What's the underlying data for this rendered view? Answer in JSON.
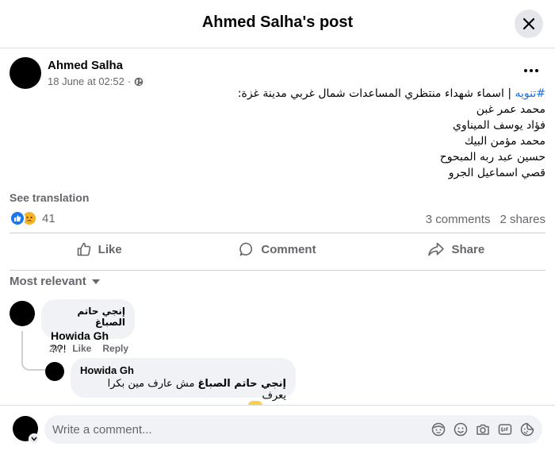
{
  "header": {
    "title": "Ahmed Salha's post",
    "close_icon": "close-icon"
  },
  "post": {
    "author": "Ahmed Salha",
    "timestamp": "18 June at 02:52",
    "audience_icon": "globe-icon",
    "hashtag": "#تنويه",
    "intro": " | اسماء شهداء منتظري المساعدات شمال غربي مدينة غزة:",
    "names": [
      "محمد عمر غبن",
      "فؤاد يوسف الميناوي",
      "محمد مؤمن البيك",
      "حسين عبد ربه المبحوح",
      "قصي اسماعيل الجرو"
    ],
    "see_translation": "See translation",
    "reaction_count": "41",
    "comments_count": "3 comments",
    "shares_count": "2 shares"
  },
  "actions": {
    "like": "Like",
    "comment": "Comment",
    "share": "Share"
  },
  "sort_label": "Most relevant",
  "comments": [
    {
      "author": "إنجي حاتم الصباغ",
      "mention": "Howida Gh",
      "text": " ??!",
      "time": "2w",
      "like": "Like",
      "reply": "Reply"
    },
    {
      "author": "Howida Gh",
      "mention": "إنجي حاتم الصباغ",
      "text": " مش عارف مين بكرا يعرف"
    }
  ],
  "composer": {
    "placeholder": "Write a comment..."
  },
  "colors": {
    "link": "#216fdb",
    "like_blue": "#1877f2",
    "sad_yellow": "#f7b125",
    "secondary_text": "#65676b"
  }
}
